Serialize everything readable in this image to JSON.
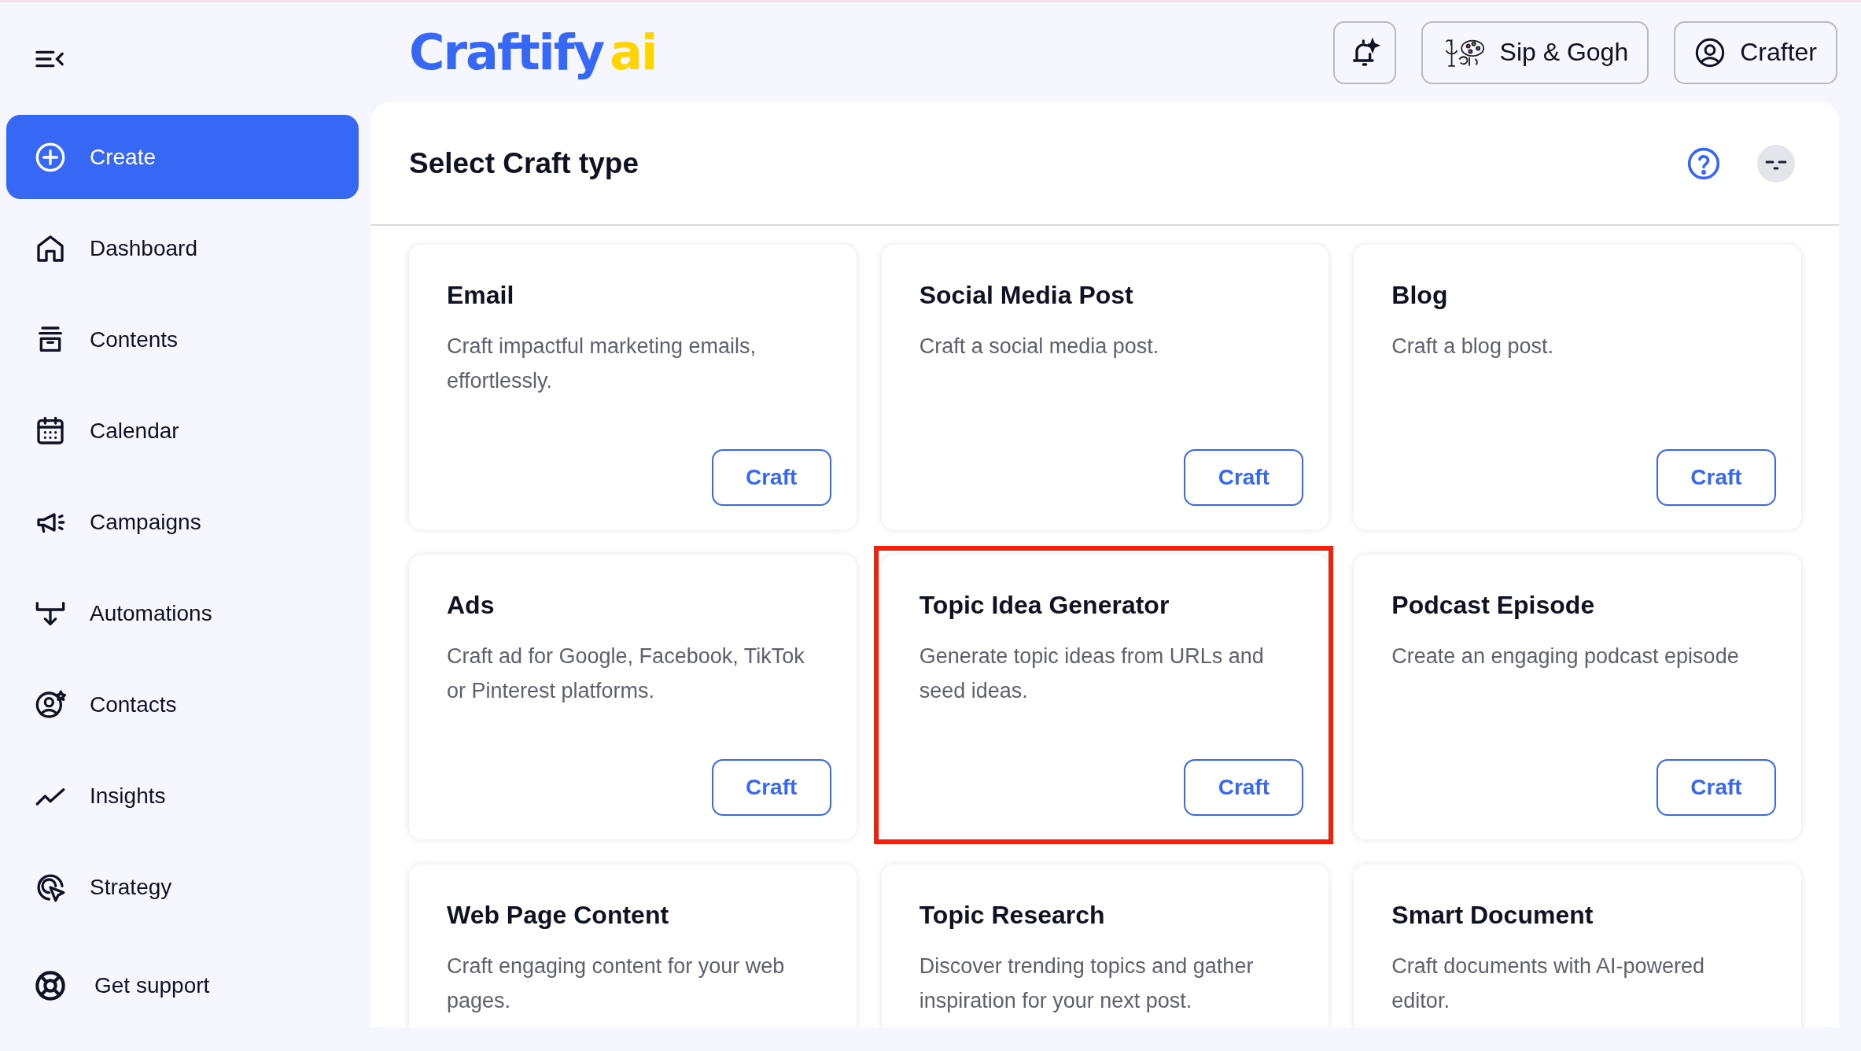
{
  "logo": {
    "main": "Craftify",
    "accent": "ai"
  },
  "header_buttons": {
    "workspace": "Sip & Gogh",
    "user": "Crafter"
  },
  "sidebar": {
    "items": [
      {
        "label": "Create",
        "selected": true
      },
      {
        "label": "Dashboard",
        "selected": false
      },
      {
        "label": "Contents",
        "selected": false
      },
      {
        "label": "Calendar",
        "selected": false
      },
      {
        "label": "Campaigns",
        "selected": false
      },
      {
        "label": "Automations",
        "selected": false
      },
      {
        "label": "Contacts",
        "selected": false
      },
      {
        "label": "Insights",
        "selected": false
      },
      {
        "label": "Strategy",
        "selected": false
      }
    ],
    "support": "Get support"
  },
  "panel": {
    "title": "Select Craft type"
  },
  "cards": [
    {
      "title": "Email",
      "description": "Craft impactful marketing emails, effortlessly.",
      "button": "Craft",
      "highlighted": false
    },
    {
      "title": "Social Media Post",
      "description": "Craft a social media post.",
      "button": "Craft",
      "highlighted": false
    },
    {
      "title": "Blog",
      "description": "Craft a blog post.",
      "button": "Craft",
      "highlighted": false
    },
    {
      "title": "Ads",
      "description": "Craft ad for Google, Facebook, TikTok or Pinterest platforms.",
      "button": "Craft",
      "highlighted": false
    },
    {
      "title": "Topic Idea Generator",
      "description": "Generate topic ideas from URLs and seed ideas.",
      "button": "Craft",
      "highlighted": true
    },
    {
      "title": "Podcast Episode",
      "description": "Create an engaging podcast episode",
      "button": "Craft",
      "highlighted": false
    },
    {
      "title": "Web Page Content",
      "description": "Craft engaging content for your web pages.",
      "highlighted": false
    },
    {
      "title": "Topic Research",
      "description": "Discover trending topics and gather inspiration for your next post.",
      "highlighted": false
    },
    {
      "title": "Smart Document",
      "description": "Craft documents with AI-powered editor.",
      "highlighted": false
    }
  ]
}
